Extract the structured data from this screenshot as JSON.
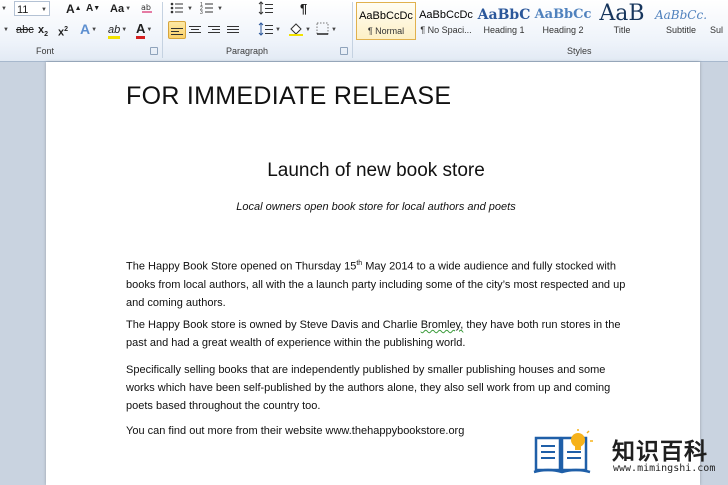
{
  "ribbon": {
    "font_group": {
      "label": "Font",
      "size_value": "11",
      "grow_font": "A",
      "shrink_font": "A",
      "change_case": "Aa",
      "subscript": "x",
      "subscript_mark": "2",
      "superscript": "x",
      "superscript_mark": "2",
      "text_effects": "A",
      "highlight": "ab",
      "font_color": "A"
    },
    "paragraph_group": {
      "label": "Paragraph",
      "show_marks": "¶"
    },
    "styles_group": {
      "label": "Styles",
      "styles": [
        {
          "preview": "AaBbCcDc",
          "name": "¶ Normal"
        },
        {
          "preview": "AaBbCcDc",
          "name": "¶ No Spaci..."
        },
        {
          "preview": "AaBbC",
          "name": "Heading 1"
        },
        {
          "preview": "AaBbCc",
          "name": "Heading 2"
        },
        {
          "preview": "AaB",
          "name": "Title"
        },
        {
          "preview": "AaBbCc.",
          "name": "Subtitle"
        },
        {
          "preview": "",
          "name": "Sul"
        }
      ]
    },
    "colors": {
      "highlight": "#f2e200",
      "font_color": "#d42020",
      "accent": "#2b579a"
    }
  },
  "document": {
    "release": "FOR IMMEDIATE RELEASE",
    "title": "Launch of new book store",
    "subtitle": "Local owners open book store for local authors and poets",
    "p1_before": "The Happy Book Store opened on Thursday 15",
    "p1_sup": "th",
    "p1_after": "  May 2014  to a wide audience and fully stocked with books from local authors, all with the a launch party including some of the city’s most respected and up and coming authors.",
    "p2_before": "The Happy Book store is owned by Steve Davis and Charlie ",
    "p2_flag": "Bromley,",
    "p2_after": " they have both run stores in the past and had a great wealth of experience within the publishing world.",
    "p3": "Specifically selling books that are independently published by smaller publishing houses and some works which have been self-published by the authors alone, they also sell work from up and coming poets based throughout the country too.",
    "p4": "You can find out more from their website www.thehappybookstore.org"
  },
  "watermark": {
    "name": "知识百科",
    "url": "www.mimingshi.com"
  }
}
